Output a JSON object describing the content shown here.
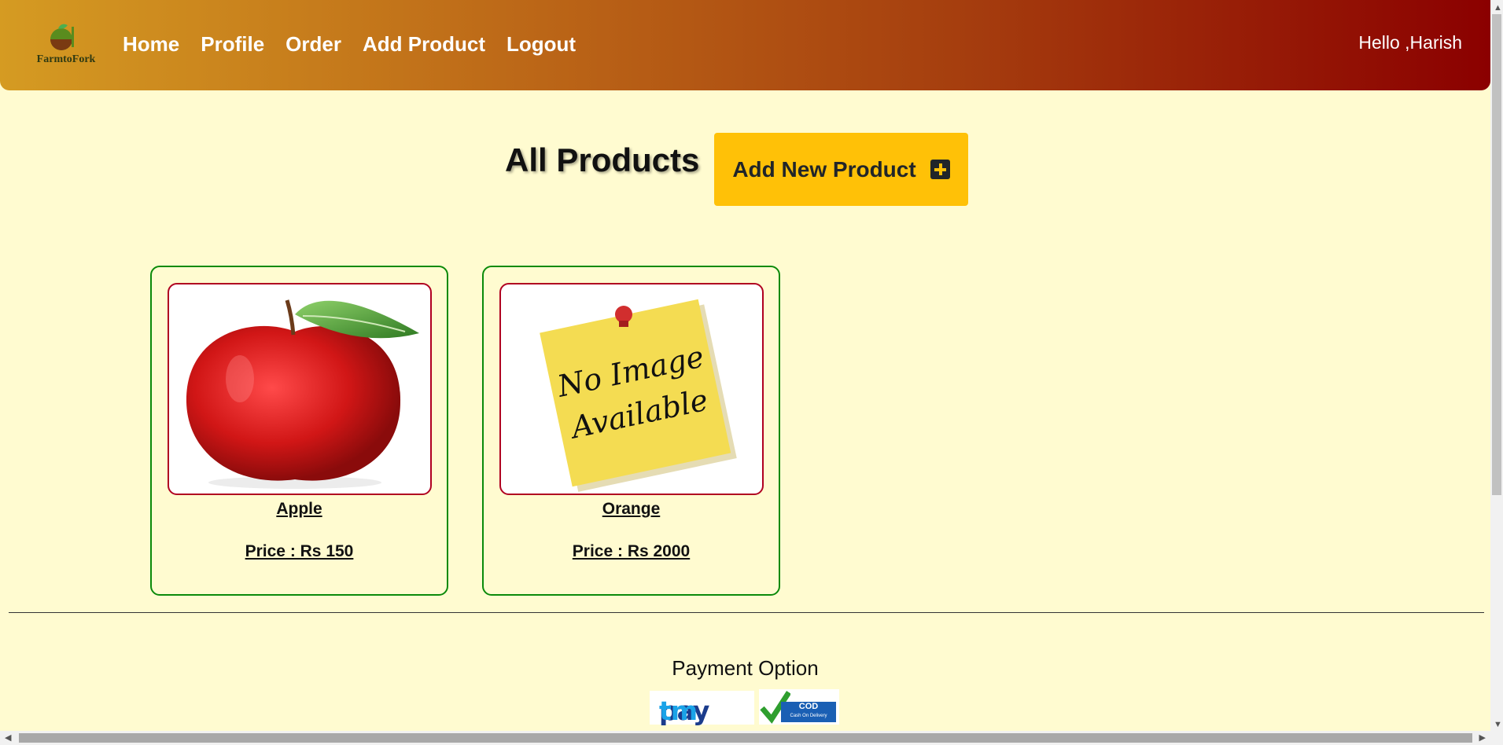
{
  "header": {
    "logo": {
      "text": "FarmtoFork",
      "icon": "farm-to-fork-logo"
    },
    "nav": [
      "Home",
      "Profile",
      "Order",
      "Add Product",
      "Logout"
    ],
    "greeting": "Hello ,Harish"
  },
  "main": {
    "title": "All Products",
    "add_button": {
      "label": "Add New Product",
      "icon": "plus-square-icon"
    }
  },
  "products": [
    {
      "name": "Apple",
      "price": "Price : Rs 150",
      "image": "apple-image"
    },
    {
      "name": "Orange",
      "price": "Price : Rs 2000",
      "image": "no-image-available",
      "placeholder_text": [
        "No Image",
        "Available"
      ]
    }
  ],
  "footer": {
    "payment_title": "Payment Option",
    "methods": [
      {
        "name": "paytm",
        "label": "Paytm"
      },
      {
        "name": "cod",
        "label": "COD",
        "sub_label": "Cash On Delivery"
      }
    ]
  },
  "colors": {
    "background": "#fffbd0",
    "header_gradient_start": "#d59b22",
    "header_gradient_end": "#8b0000",
    "button": "#ffc107",
    "card_border": "#0a8a0a",
    "image_border": "#b00020"
  }
}
